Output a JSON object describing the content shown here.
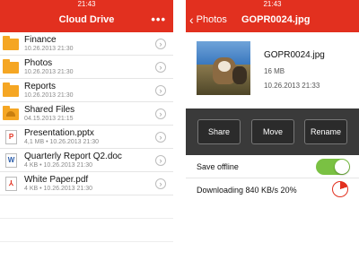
{
  "colors": {
    "accent": "#e2301f",
    "toggle_on": "#7ac143",
    "action_bar": "#3a3a3a"
  },
  "left": {
    "status_time": "21:43",
    "title": "Cloud Drive",
    "more_icon": "more-dots-icon",
    "files": [
      {
        "name": "Finance",
        "meta": "10.26.2013 21:30",
        "icon": "folder-icon"
      },
      {
        "name": "Photos",
        "meta": "10.26.2013 21:30",
        "icon": "folder-icon"
      },
      {
        "name": "Reports",
        "meta": "10.26.2013 21:30",
        "icon": "folder-icon"
      },
      {
        "name": "Shared Files",
        "meta": "04.15.2013 21:15",
        "icon": "shared-folder-icon"
      },
      {
        "name": "Presentation.pptx",
        "meta": "4,1 MB • 10.26.2013 21:30",
        "icon": "powerpoint-file-icon"
      },
      {
        "name": "Quarterly Report Q2.doc",
        "meta": "4 KB • 10.26.2013 21:30",
        "icon": "word-file-icon"
      },
      {
        "name": "White Paper.pdf",
        "meta": "4 KB • 10.26.2013 21:30",
        "icon": "pdf-file-icon"
      }
    ]
  },
  "right": {
    "status_time": "21:43",
    "back_label": "Photos",
    "title": "GOPR0024.jpg",
    "file": {
      "name": "GOPR0024.jpg",
      "size": "16 MB",
      "date": "10.26.2013 21:33"
    },
    "actions": {
      "share": "Share",
      "move": "Move",
      "rename": "Rename"
    },
    "save_offline_label": "Save offline",
    "save_offline_on": true,
    "download_label": "Downloading 840 KB/s 20%",
    "download_progress": 0.2
  }
}
